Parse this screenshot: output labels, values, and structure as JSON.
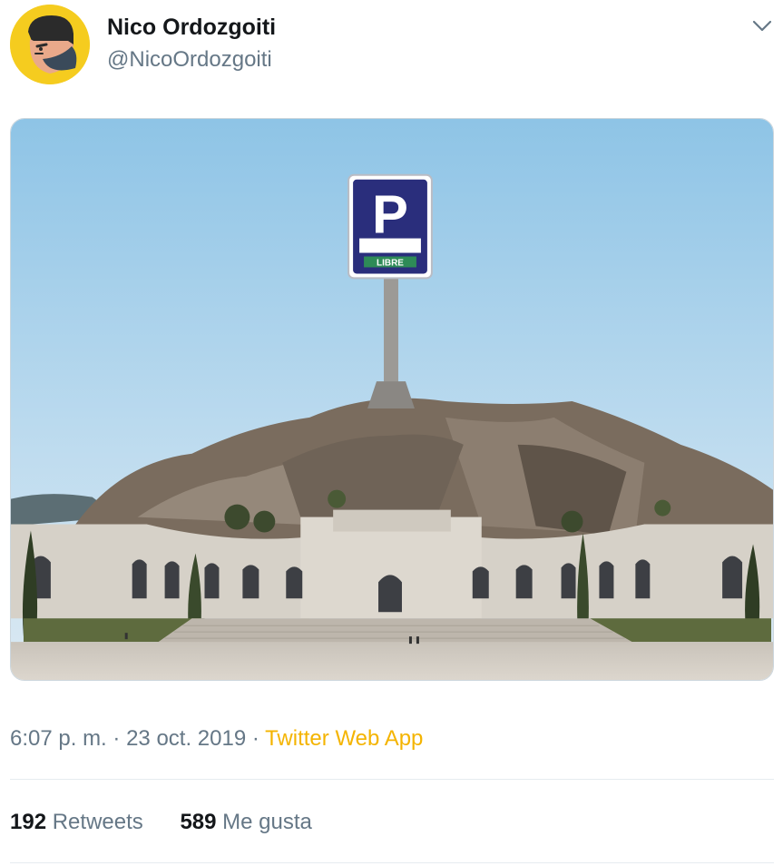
{
  "author": {
    "name": "Nico Ordozgoiti",
    "handle": "@NicoOrdozgoiti",
    "avatar_icon": "cartoon-face-avatar-icon",
    "avatar_bg": "#f5cc1f"
  },
  "menu_icon": "chevron-down-icon",
  "image": {
    "sign_text": "LIBRE",
    "sign_letter": "P",
    "sign_color": "#2a2e7c",
    "sign_label_color": "#2e8b57"
  },
  "tweet_meta": {
    "time": "6:07 p. m.",
    "separator": "·",
    "date": "23 oct. 2019",
    "source": "Twitter Web App",
    "source_color": "#f4b400"
  },
  "stats": {
    "retweets_count": "192",
    "retweets_label": "Retweets",
    "likes_count": "589",
    "likes_label": "Me gusta"
  }
}
